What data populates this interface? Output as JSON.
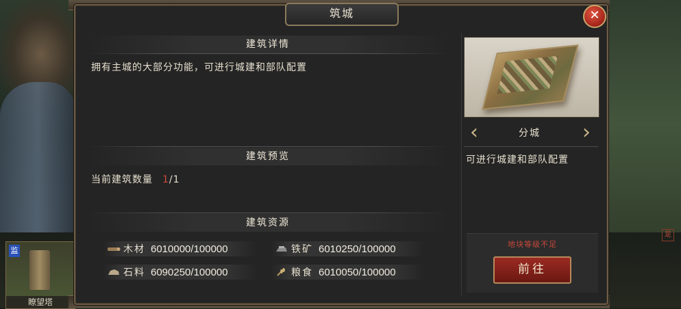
{
  "dialog": {
    "title": "筑城",
    "close_glyph": "✕"
  },
  "details": {
    "heading": "建筑详情",
    "description": "拥有主城的大部分功能，可进行城建和部队配置"
  },
  "preview": {
    "heading": "建筑预览",
    "count_label": "当前建筑数量",
    "count_current": "1",
    "count_total": "/1"
  },
  "resources": {
    "heading": "建筑资源",
    "items": [
      {
        "name": "木材",
        "value": "6010000/100000",
        "icon": "wood-icon"
      },
      {
        "name": "铁矿",
        "value": "6010250/100000",
        "icon": "iron-icon"
      },
      {
        "name": "石料",
        "value": "6090250/100000",
        "icon": "stone-icon"
      },
      {
        "name": "粮食",
        "value": "6010050/100000",
        "icon": "grain-icon"
      }
    ]
  },
  "building": {
    "name": "分城",
    "description": "可进行城建和部队配置",
    "prev_glyph": "‹",
    "next_glyph": "›",
    "warning": "地块等级不足",
    "goto_label": "前往"
  },
  "background": {
    "left_thumb_badge": "监",
    "left_thumb_label": "瞭望塔",
    "right_corner_glyph": "足"
  },
  "colors": {
    "accent_red": "#c8483a",
    "panel_bg": "#242424",
    "frame_gold": "#8b7a5c"
  }
}
